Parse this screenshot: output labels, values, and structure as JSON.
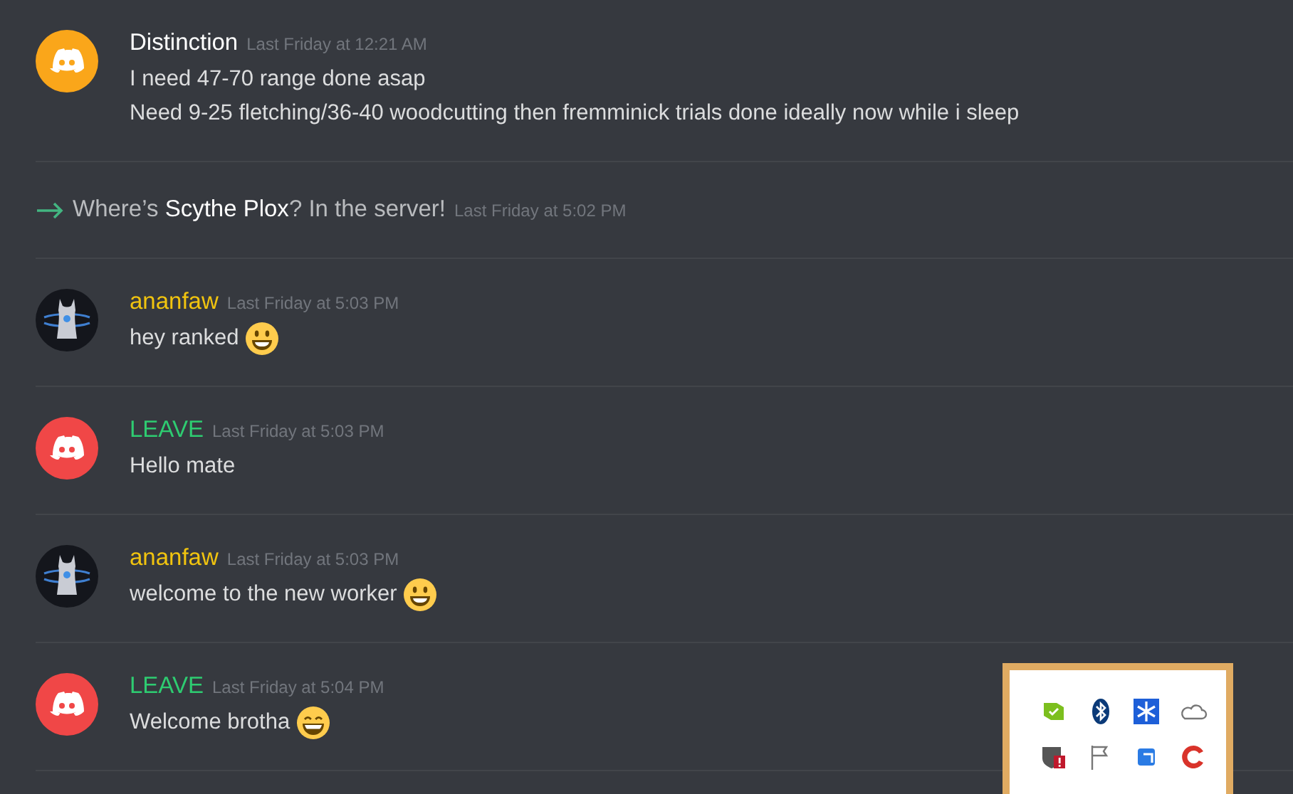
{
  "messages": [
    {
      "kind": "message",
      "author": {
        "name": "Distinction",
        "color": "#ffffff"
      },
      "avatar": {
        "kind": "logo",
        "color": "#faa61a"
      },
      "timestamp": "Last Friday at 12:21 AM",
      "lines": [
        "I need 47-70 range done asap",
        "Need 9-25 fletching/36-40 woodcutting then fremminick trials done ideally now while i sleep"
      ]
    },
    {
      "kind": "join",
      "text": "Where’s **Scythe Plox**? In the server!",
      "timestamp": "Last Friday at 5:02 PM"
    },
    {
      "kind": "message",
      "author": {
        "name": "ananfaw",
        "color": "#f1c40f"
      },
      "avatar": {
        "kind": "photo"
      },
      "timestamp": "Last Friday at 5:03 PM",
      "lines": [
        "hey ranked"
      ],
      "emoji": {
        "kind": "smiley"
      }
    },
    {
      "kind": "message",
      "author": {
        "name": "LEAVE",
        "color": "#2ecc71"
      },
      "avatar": {
        "kind": "logo",
        "color": "#f04747"
      },
      "timestamp": "Last Friday at 5:03 PM",
      "lines": [
        "Hello mate"
      ]
    },
    {
      "kind": "message",
      "author": {
        "name": "ananfaw",
        "color": "#f1c40f"
      },
      "avatar": {
        "kind": "photo"
      },
      "timestamp": "Last Friday at 5:03 PM",
      "lines": [
        "welcome to the new worker"
      ],
      "emoji": {
        "kind": "smiley"
      }
    },
    {
      "kind": "message",
      "author": {
        "name": "LEAVE",
        "color": "#2ecc71"
      },
      "avatar": {
        "kind": "logo",
        "color": "#f04747"
      },
      "timestamp": "Last Friday at 5:04 PM",
      "lines": [
        "Welcome brotha"
      ],
      "emoji": {
        "kind": "grin"
      }
    }
  ]
}
